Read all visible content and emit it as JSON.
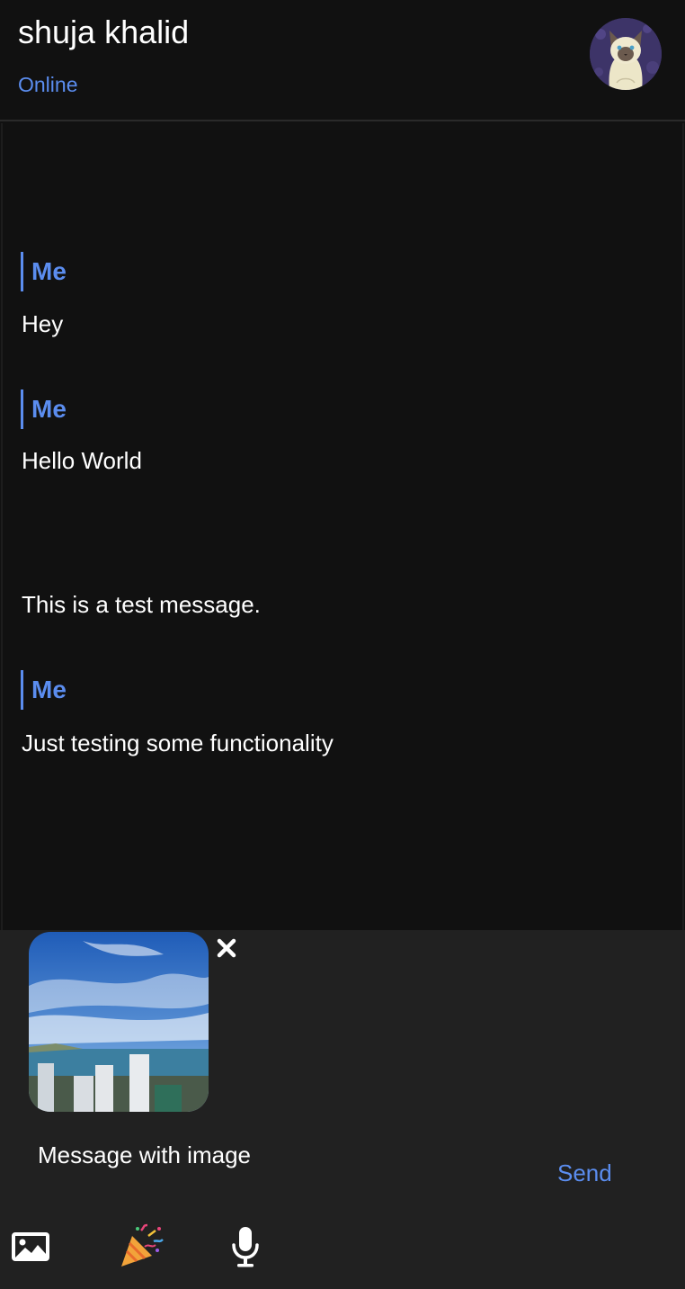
{
  "header": {
    "contact_name": "shuja khalid",
    "status": "Online",
    "avatar_icon": "cat-avatar"
  },
  "messages": [
    {
      "sender": "Me",
      "lines": [
        "Hey"
      ]
    },
    {
      "sender": "Me",
      "lines": [
        "Hello World",
        "This is a test message."
      ]
    },
    {
      "sender": "Me",
      "lines": [
        "Just testing some functionality"
      ]
    }
  ],
  "composer": {
    "attachment_icon": "image-preview",
    "remove_icon": "close-icon",
    "input_value": "Message with image",
    "send_label": "Send",
    "tools": [
      "image-icon",
      "party-popper-icon",
      "microphone-icon"
    ]
  },
  "colors": {
    "accent": "#5b8def",
    "background": "#111111",
    "composer_bg": "#212121"
  }
}
